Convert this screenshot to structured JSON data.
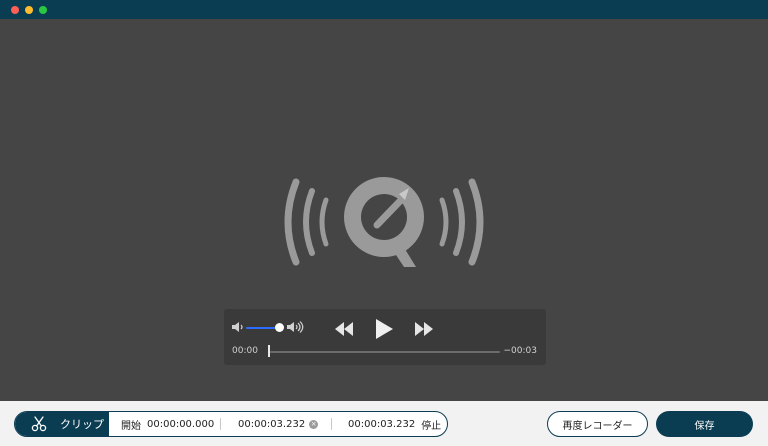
{
  "window": {
    "buttons": [
      "close",
      "minimize",
      "maximize"
    ]
  },
  "player": {
    "logo_icon": "quicktime-broadcast-icon",
    "volume_level": 0.85,
    "time_elapsed": "00:00",
    "time_remaining": "−00:03",
    "progress": 0.0
  },
  "clip": {
    "tab_label": "クリップ",
    "start_label": "開始",
    "start_time": "00:00:00.000",
    "duration": "00:00:03.232",
    "end_time": "00:00:03.232",
    "end_label": "停止"
  },
  "actions": {
    "rerecord_label": "再度レコーダー",
    "save_label": "保存"
  },
  "colors": {
    "accent": "#0b3d52",
    "volume_fill": "#2c6cff",
    "player_bg": "#454545"
  }
}
